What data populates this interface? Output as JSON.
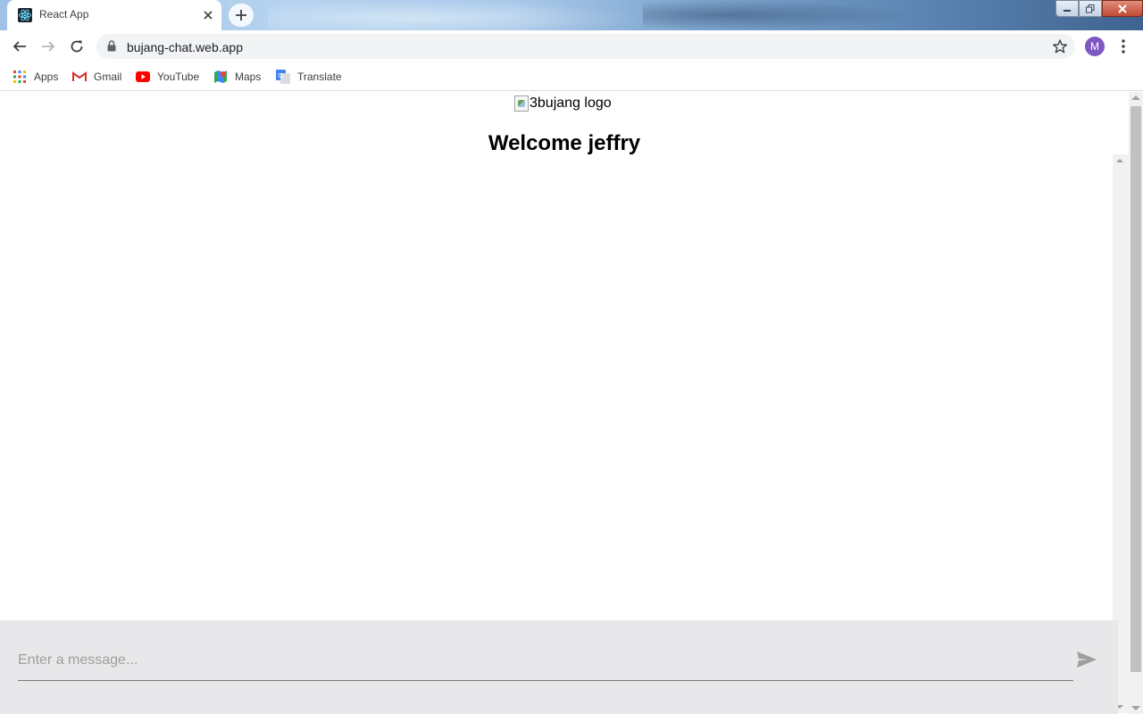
{
  "browser": {
    "tab": {
      "title": "React App",
      "favicon": "react-icon"
    },
    "address_bar": {
      "url": "bujang-chat.web.app"
    },
    "profile_initial": "M",
    "bookmarks": [
      {
        "label": "Apps",
        "icon": "apps-grid-icon"
      },
      {
        "label": "Gmail",
        "icon": "gmail-icon"
      },
      {
        "label": "YouTube",
        "icon": "youtube-icon"
      },
      {
        "label": "Maps",
        "icon": "maps-icon"
      },
      {
        "label": "Translate",
        "icon": "translate-icon"
      }
    ]
  },
  "page": {
    "logo_alt": "3bujang logo",
    "welcome": "Welcome jeffry",
    "composer": {
      "placeholder": "Enter a message...",
      "value": ""
    }
  },
  "colors": {
    "avatar": "#7e57c2",
    "composer_bg": "#e8e8ea",
    "omnibox_bg": "#f1f3f4"
  }
}
